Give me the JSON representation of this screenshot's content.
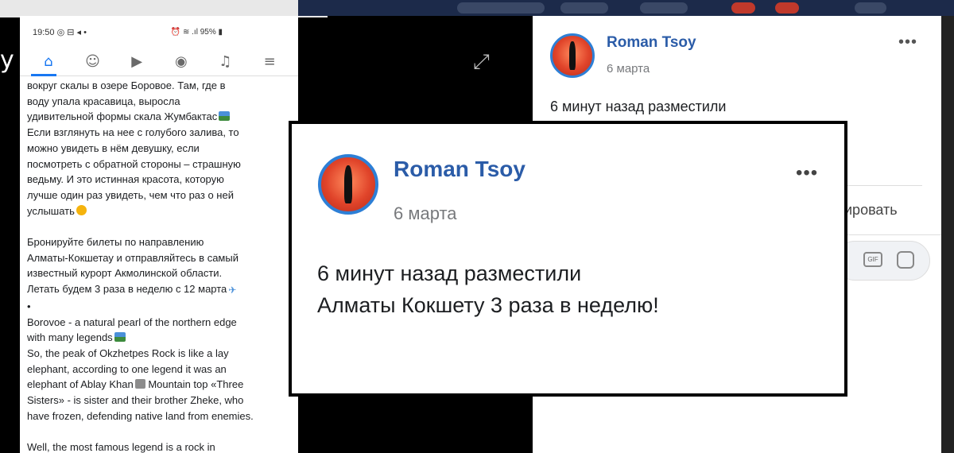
{
  "phone": {
    "status_time": "19:50",
    "status_icons": "◎ ⊟ ◂ •",
    "status_right": "⏰ ≋ .ıl 95% ▮",
    "nav_icons": [
      "home-icon",
      "groups-icon",
      "watch-icon",
      "profile-icon",
      "notifications-icon",
      "menu-icon"
    ],
    "paragraph1_lines": [
      "вокруг скалы в озере Боровое. Там, где в",
      "воду упала красавица, выросла",
      "удивительной формы скала Жумбактас",
      "Если взглянуть на нее с голубого залива, то",
      "можно увидеть в нём девушку, если",
      "посмотреть с обратной стороны – страшную",
      "ведьму. И это истинная красота, которую",
      "лучше один раз увидеть, чем что раз о ней",
      "услышать"
    ],
    "paragraph2_lines": [
      "Бронируйте билеты по направлению",
      "Алматы-Кокшетау и отправляйтесь в самый",
      "известный курорт Акмолинской области.",
      "Летать будем 3 раза в неделю с 12 марта",
      "•",
      "Borovoe - a natural pearl of the northern edge",
      "with many legends",
      "So, the peak of Okzhetpes Rock is like a lay",
      "elephant, according to one legend it was an",
      "elephant of Ablay Khan",
      "Sisters» - is sister and their brother Zheke, who",
      "have frozen, defending native land from enemies."
    ],
    "elephant_line_tail": " Mountain top «Three",
    "paragraph3_lines": [
      "Well, the most famous legend is a rock in"
    ]
  },
  "post": {
    "author": "Roman Tsoy",
    "date": "6 марта",
    "more": "•••",
    "line1": "6 минут назад разместили",
    "line2": "Алматы Кокшету 3 раза в неделю!",
    "action_partial": "ировать",
    "gif_label": "GIF"
  },
  "left_edge_glyph": "y",
  "colors": {
    "accent": "#1877f2",
    "author_name": "#2b5ca8",
    "avatar_border": "#2d7fd6"
  }
}
